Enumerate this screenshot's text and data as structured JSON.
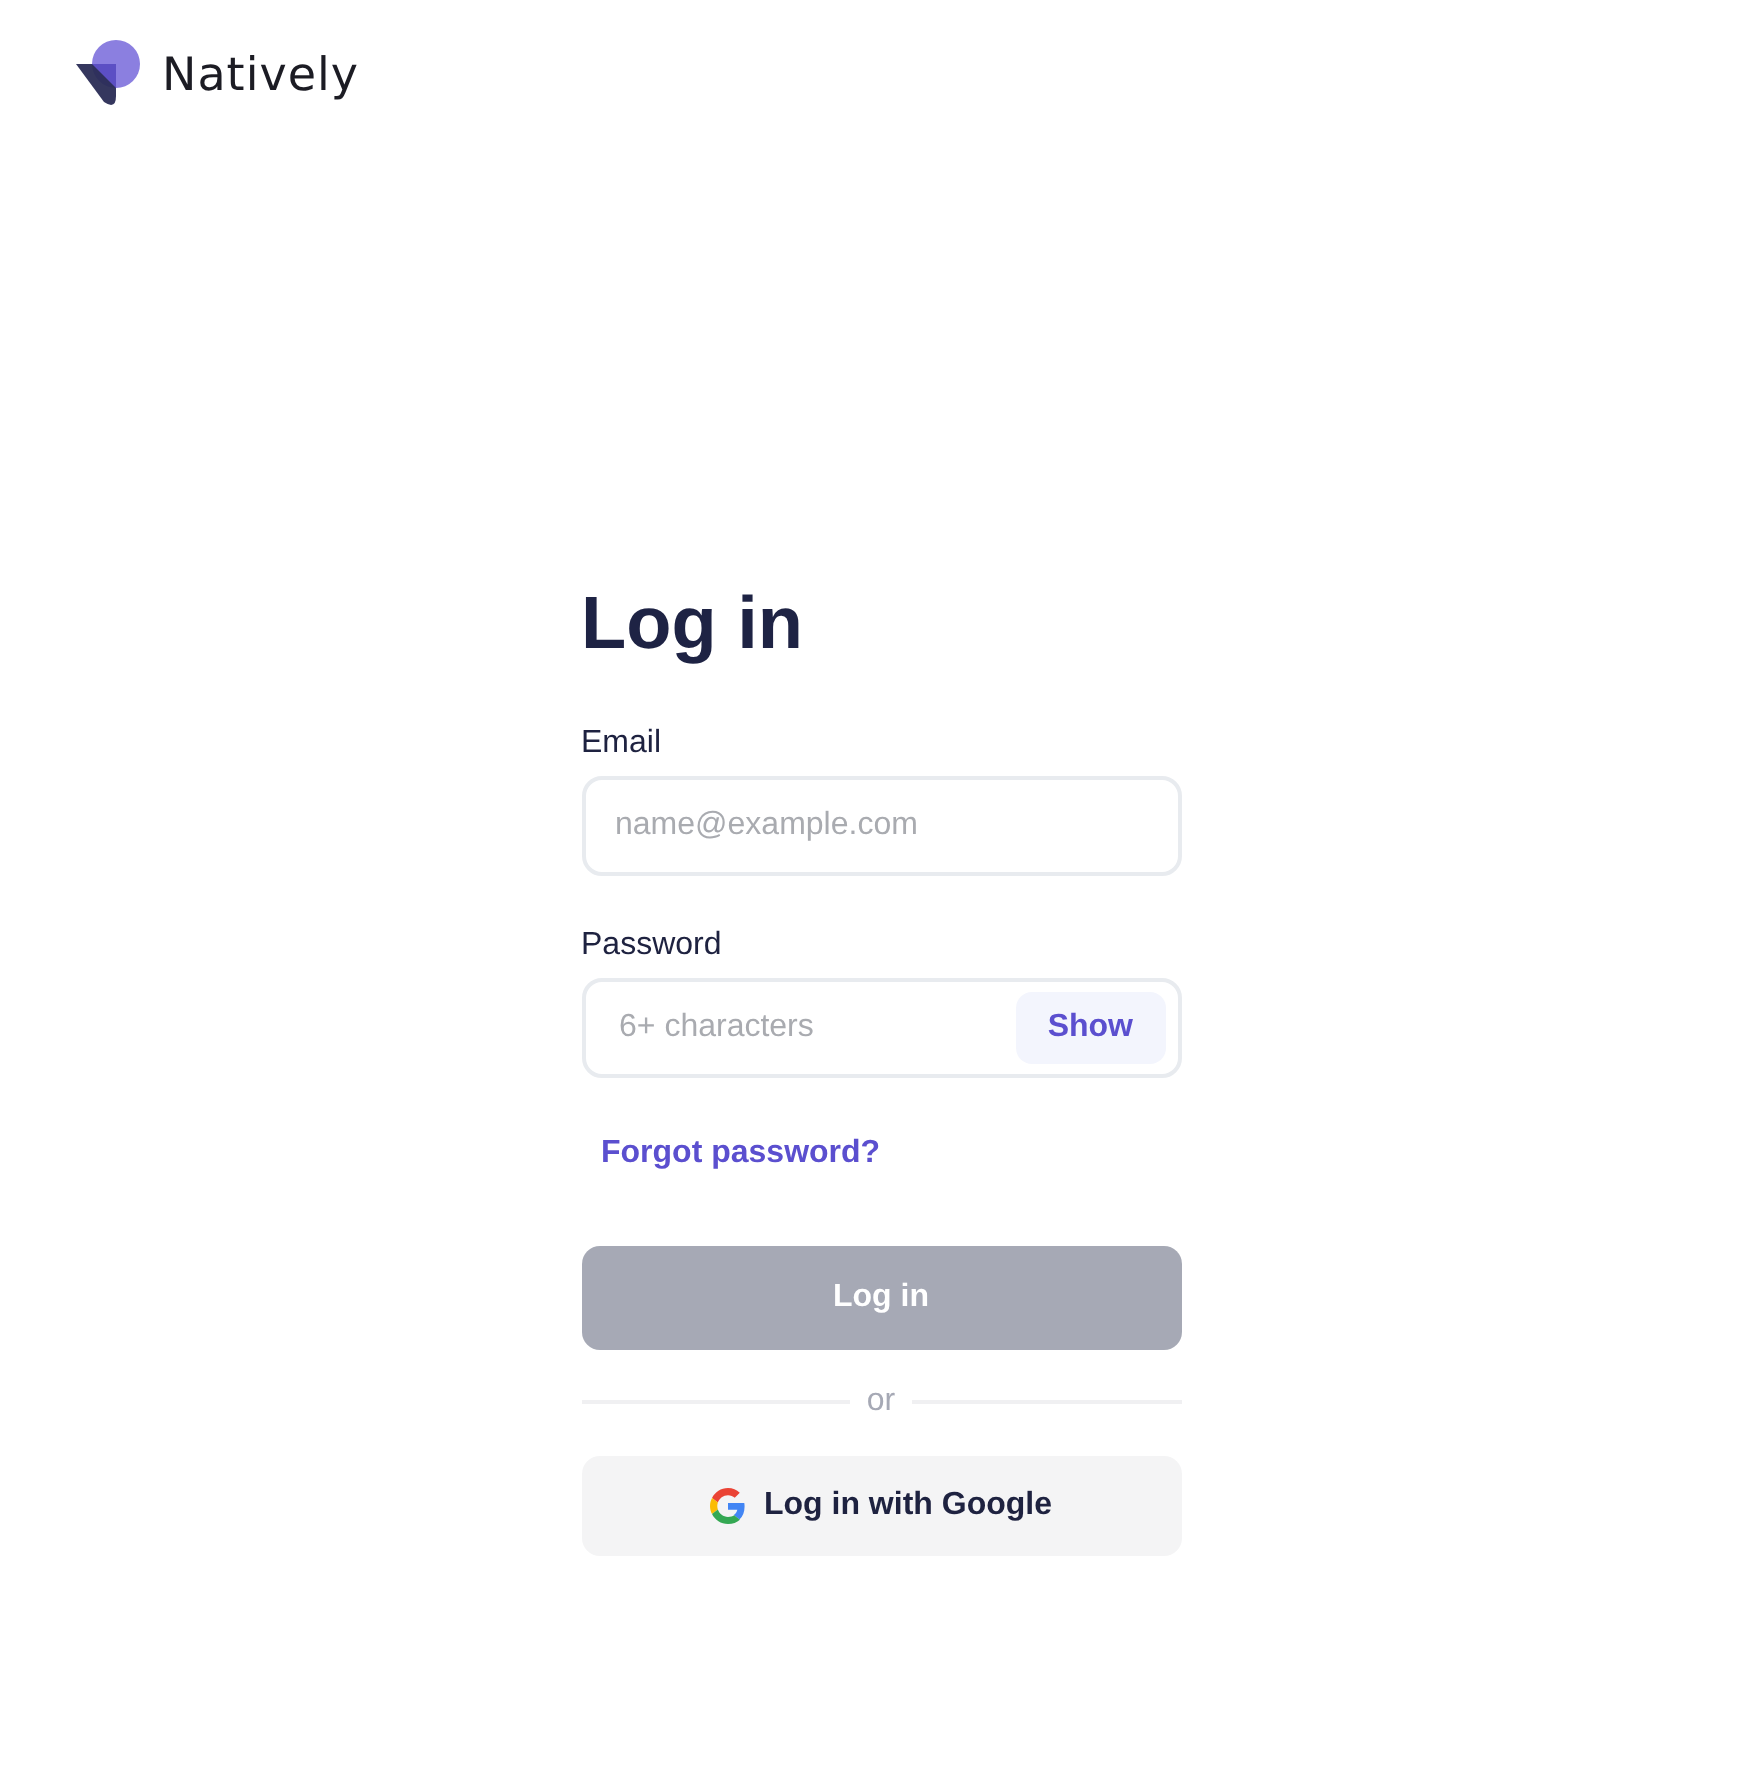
{
  "brand": {
    "name": "Natively"
  },
  "form": {
    "title": "Log in",
    "fields": [
      {
        "label": "Email",
        "placeholder": "name@example.com",
        "kind": "email"
      },
      {
        "label": "Password",
        "placeholder": "6+ characters",
        "kind": "password",
        "toggle": "Show"
      }
    ],
    "forgot_link": "Forgot password?",
    "submit": {
      "label": "Log in",
      "disabled": true
    },
    "divider": "or",
    "google_button": "Log in with Google"
  }
}
